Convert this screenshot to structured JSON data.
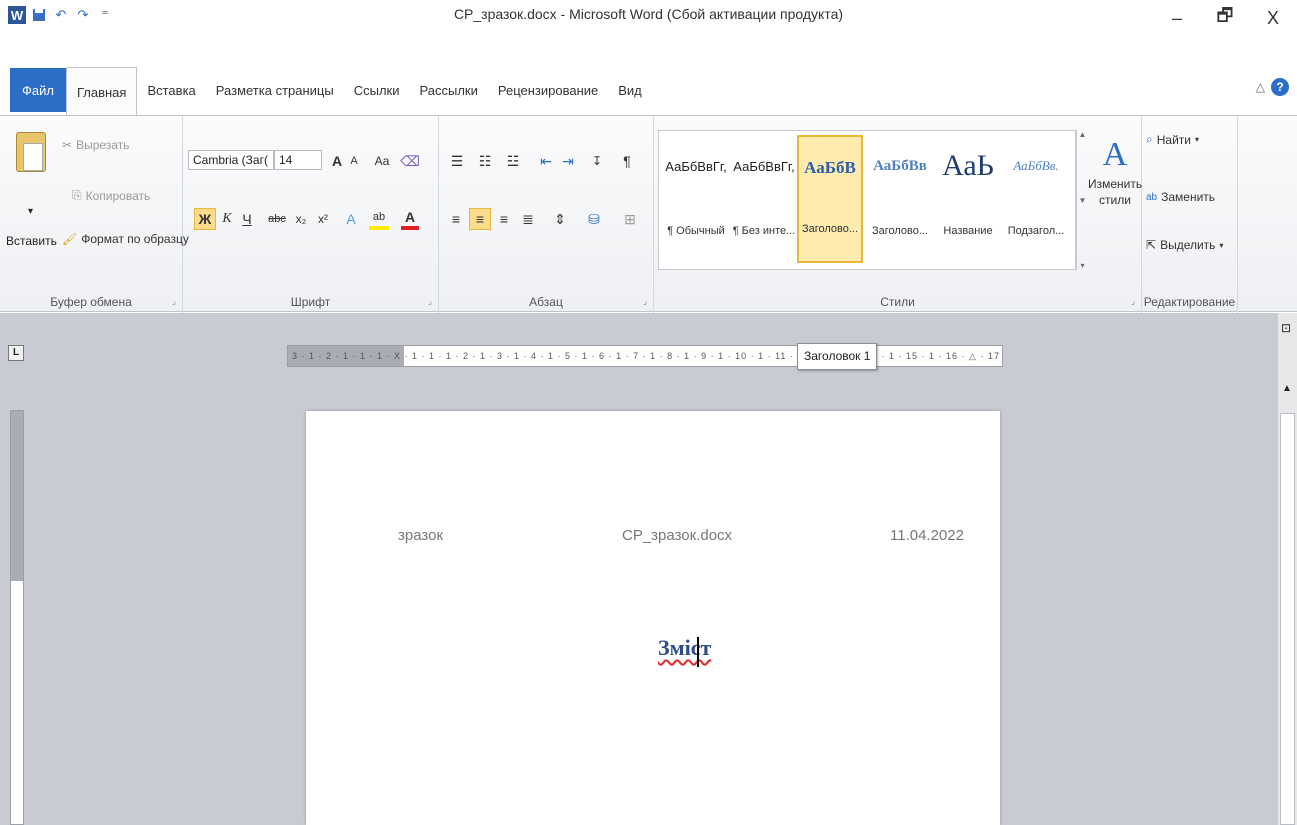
{
  "window": {
    "title": "CP_зразок.docx - Microsoft Word (Сбой активации продукта)",
    "minimize": "–",
    "restore": "🗗",
    "close": "X"
  },
  "qat": {
    "word_icon": "W",
    "save_icon": "save-icon",
    "undo": "↶",
    "redo": "↷",
    "customize": "⁼"
  },
  "tabs": [
    "Файл",
    "Главная",
    "Вставка",
    "Разметка страницы",
    "Ссылки",
    "Рассылки",
    "Рецензирование",
    "Вид"
  ],
  "active_tab": "Главная",
  "clipboard": {
    "paste": "Вставить",
    "paste_arrow": "▾",
    "cut": "Вырезать",
    "copy": "Копировать",
    "format_painter": "Формат по образцу",
    "label": "Буфер обмена"
  },
  "font": {
    "name": "Cambria (Заг(",
    "size": "14",
    "grow": "A",
    "shrink": "A",
    "case": "Aa",
    "bold": "Ж",
    "italic": "К",
    "underline": "Ч",
    "strike": "abc",
    "subscript": "x₂",
    "superscript": "x²",
    "highlight": "ab",
    "color": "A",
    "label": "Шрифт"
  },
  "paragraph": {
    "label": "Абзац",
    "pilcrow": "¶"
  },
  "styles": {
    "items": [
      {
        "preview": "АаБбВвГг,",
        "name": "¶ Обычный"
      },
      {
        "preview": "АаБбВвГг,",
        "name": "¶ Без инте..."
      },
      {
        "preview": "АаБбВ",
        "name": "Заголово..."
      },
      {
        "preview": "АаБбВв",
        "name": "Заголово..."
      },
      {
        "preview": "АаЬ",
        "name": "Название"
      },
      {
        "preview": "АаБбВв.",
        "name": "Подзагол..."
      }
    ],
    "change_styles": "Изменить стили",
    "label": "Стили"
  },
  "editing": {
    "find": "Найти",
    "replace": "Заменить",
    "select": "Выделить",
    "label": "Редактирование"
  },
  "ruler": {
    "text": "3 · 1 · 2 · 1 · 1 · 1 · X · 1 · 1 · 1 · 2 · 1 · 3 · 1 · 4 · 1 · 5 · 1 · 6 · 1 · 7 · 1 · 8 · 1 · 9 · 1 · 10 · 1 · 11 · 1 ·",
    "text_right": "4 · 1 · 15 · 1 · 16 · △ · 17 · 1 ·",
    "tooltip": "Заголовок 1",
    "corner": "L"
  },
  "page": {
    "header_left": "зразок",
    "header_center": "CP_зразок.docx",
    "header_right": "11.04.2022",
    "heading": "Зміст"
  },
  "colors": {
    "accent": "#2b6ec8",
    "heading": "#2b4c8c"
  }
}
